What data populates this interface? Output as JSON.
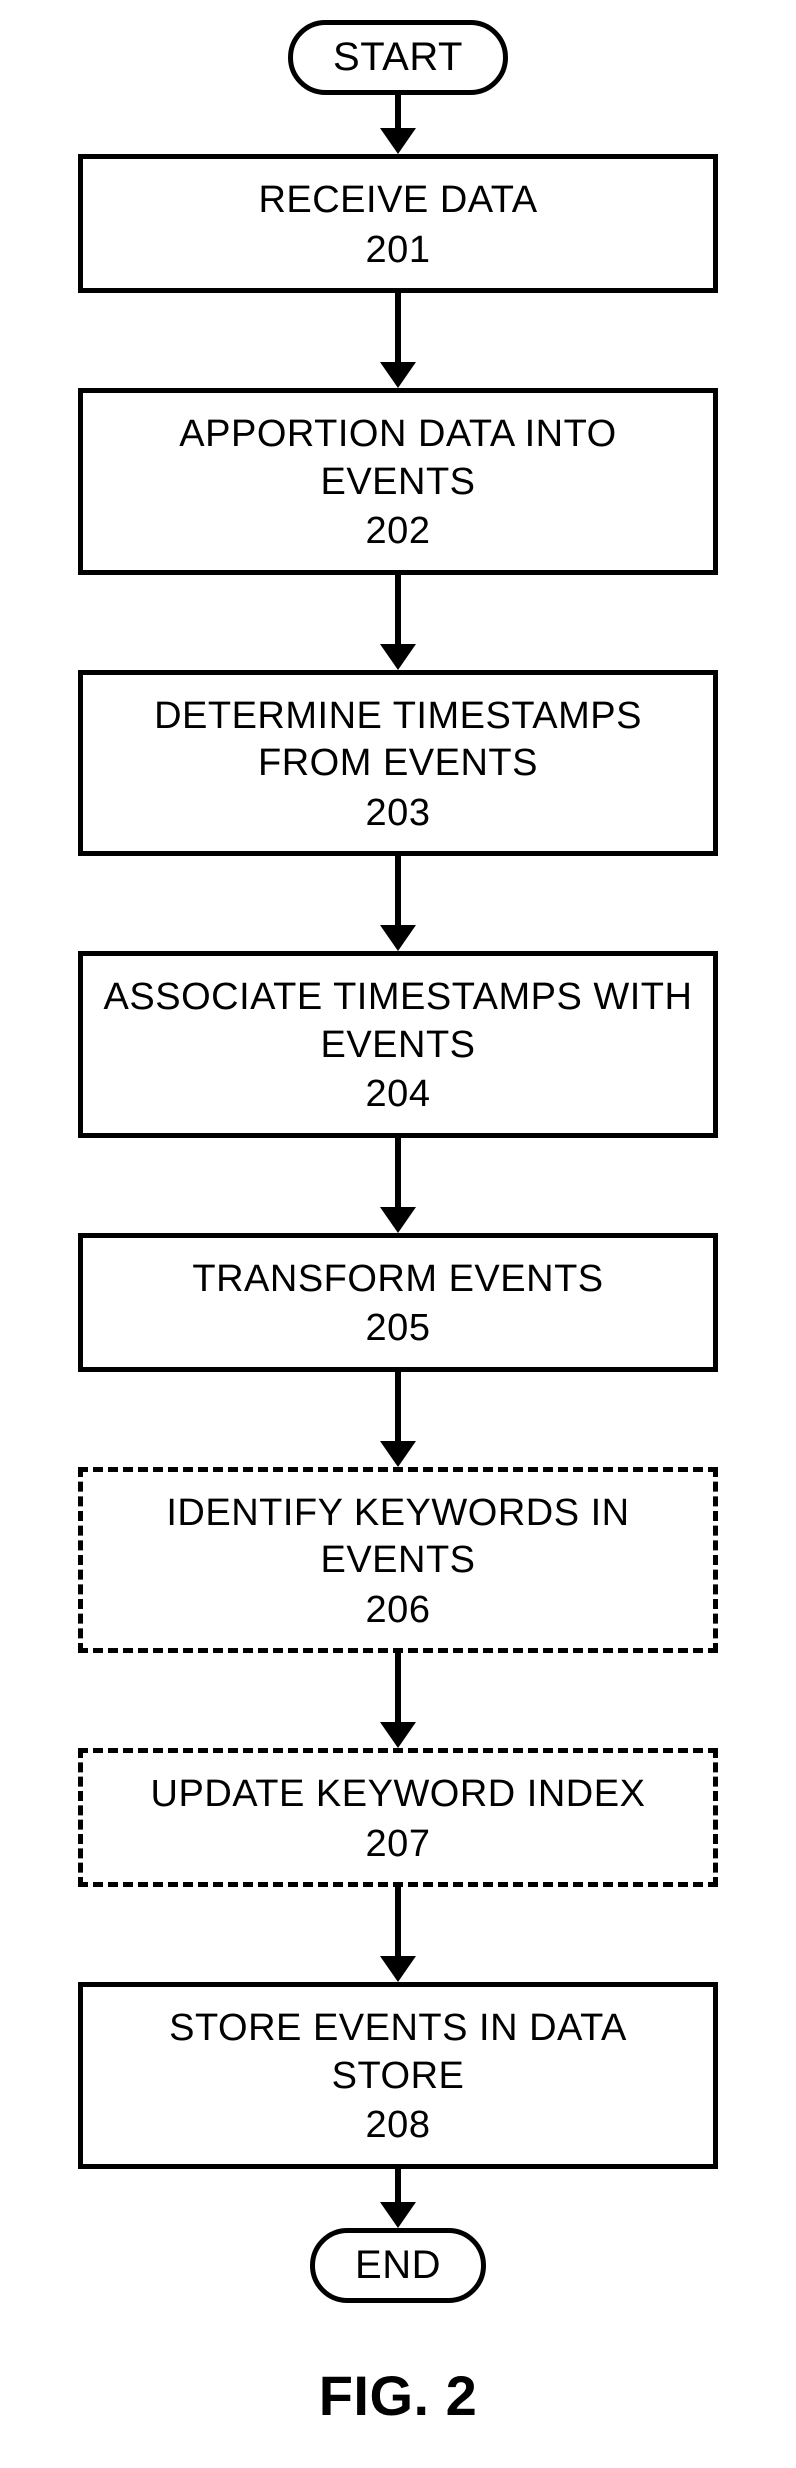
{
  "terminator": {
    "start": "START",
    "end": "END"
  },
  "steps": [
    {
      "label": "RECEIVE DATA",
      "num": "201",
      "dashed": false
    },
    {
      "label": "APPORTION DATA INTO EVENTS",
      "num": "202",
      "dashed": false
    },
    {
      "label": "DETERMINE TIMESTAMPS FROM EVENTS",
      "num": "203",
      "dashed": false
    },
    {
      "label": "ASSOCIATE TIMESTAMPS WITH EVENTS",
      "num": "204",
      "dashed": false
    },
    {
      "label": "TRANSFORM EVENTS",
      "num": "205",
      "dashed": false
    },
    {
      "label": "IDENTIFY KEYWORDS IN EVENTS",
      "num": "206",
      "dashed": true
    },
    {
      "label": "UPDATE KEYWORD INDEX",
      "num": "207",
      "dashed": true
    },
    {
      "label": "STORE EVENTS IN DATA STORE",
      "num": "208",
      "dashed": false
    }
  ],
  "figure_label": "FIG. 2",
  "chart_data": {
    "type": "flowchart",
    "direction": "top-to-bottom",
    "nodes": [
      {
        "id": "start",
        "type": "terminator",
        "text": "START"
      },
      {
        "id": "201",
        "type": "process",
        "text": "RECEIVE DATA",
        "optional": false
      },
      {
        "id": "202",
        "type": "process",
        "text": "APPORTION DATA INTO EVENTS",
        "optional": false
      },
      {
        "id": "203",
        "type": "process",
        "text": "DETERMINE TIMESTAMPS FROM EVENTS",
        "optional": false
      },
      {
        "id": "204",
        "type": "process",
        "text": "ASSOCIATE TIMESTAMPS WITH EVENTS",
        "optional": false
      },
      {
        "id": "205",
        "type": "process",
        "text": "TRANSFORM EVENTS",
        "optional": false
      },
      {
        "id": "206",
        "type": "process",
        "text": "IDENTIFY KEYWORDS IN EVENTS",
        "optional": true
      },
      {
        "id": "207",
        "type": "process",
        "text": "UPDATE KEYWORD INDEX",
        "optional": true
      },
      {
        "id": "208",
        "type": "process",
        "text": "STORE EVENTS IN DATA STORE",
        "optional": false
      },
      {
        "id": "end",
        "type": "terminator",
        "text": "END"
      }
    ],
    "edges": [
      {
        "from": "start",
        "to": "201"
      },
      {
        "from": "201",
        "to": "202"
      },
      {
        "from": "202",
        "to": "203"
      },
      {
        "from": "203",
        "to": "204"
      },
      {
        "from": "204",
        "to": "205"
      },
      {
        "from": "205",
        "to": "206"
      },
      {
        "from": "206",
        "to": "207"
      },
      {
        "from": "207",
        "to": "208"
      },
      {
        "from": "208",
        "to": "end"
      }
    ]
  }
}
